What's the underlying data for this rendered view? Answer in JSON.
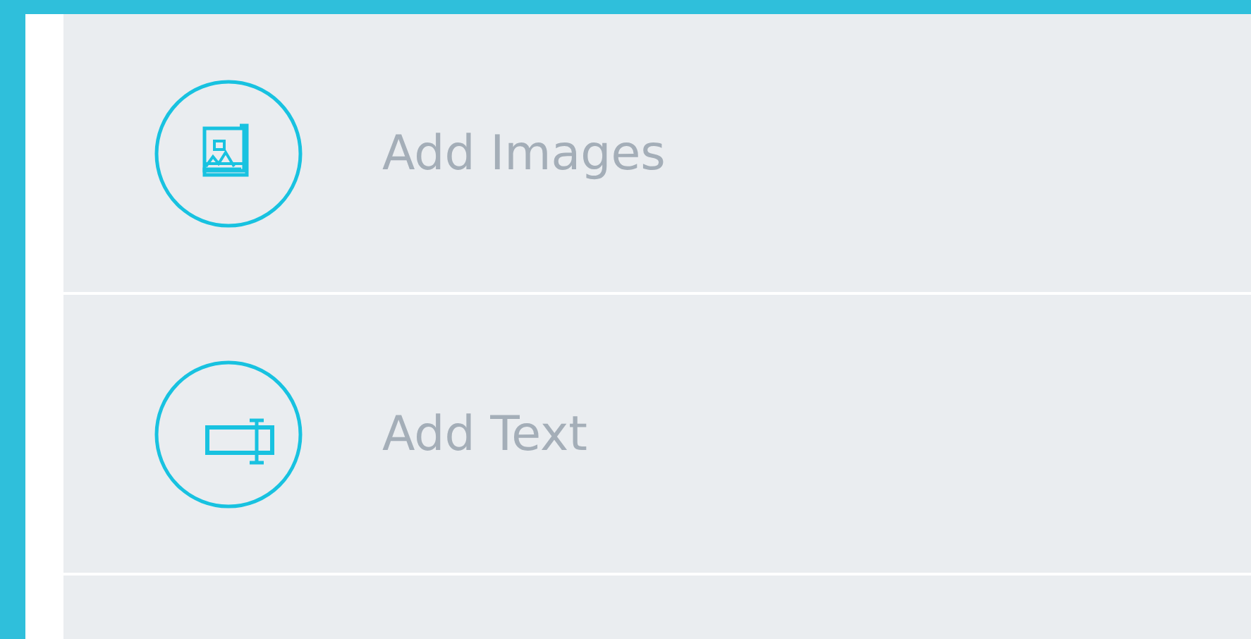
{
  "items": [
    {
      "kind": "images",
      "label": "Add Images"
    },
    {
      "kind": "text",
      "label": "Add Text"
    }
  ]
}
